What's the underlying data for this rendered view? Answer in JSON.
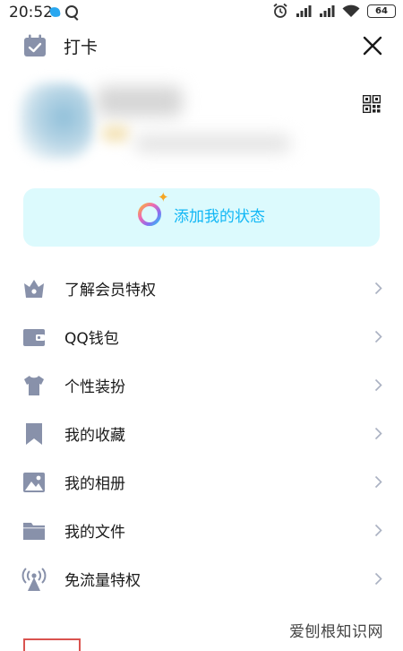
{
  "status_bar": {
    "time": "20:52",
    "battery": "64"
  },
  "header": {
    "check_in_label": "打卡"
  },
  "status_card": {
    "label": "添加我的状态"
  },
  "menu": [
    {
      "label": "了解会员特权",
      "icon": "vip-crown-icon"
    },
    {
      "label": "QQ钱包",
      "icon": "wallet-icon"
    },
    {
      "label": "个性装扮",
      "icon": "tshirt-icon"
    },
    {
      "label": "我的收藏",
      "icon": "bookmark-icon"
    },
    {
      "label": "我的相册",
      "icon": "photo-album-icon"
    },
    {
      "label": "我的文件",
      "icon": "folder-icon"
    },
    {
      "label": "免流量特权",
      "icon": "signal-tower-icon"
    }
  ],
  "watermark": "爱刨根知识网",
  "colors": {
    "accent": "#12b7f5",
    "icon": "#8891aa",
    "status_card_bg": "#dcfafd"
  }
}
